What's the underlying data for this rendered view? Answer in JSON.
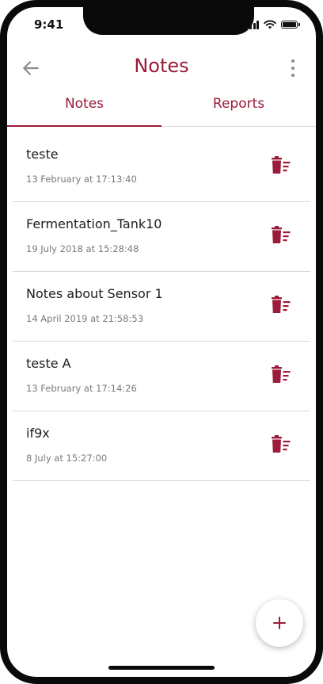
{
  "status_bar": {
    "time": "9:41"
  },
  "appbar": {
    "title": "Notes"
  },
  "tabs": [
    {
      "label": "Notes",
      "active": true
    },
    {
      "label": "Reports",
      "active": false
    }
  ],
  "notes": [
    {
      "title": "teste",
      "date": "13 February at 17:13:40"
    },
    {
      "title": "Fermentation_Tank10",
      "date": "19 July 2018 at 15:28:48"
    },
    {
      "title": "Notes about Sensor 1",
      "date": "14 April 2019 at 21:58:53"
    },
    {
      "title": "teste A",
      "date": "13 February at 17:14:26"
    },
    {
      "title": "if9x",
      "date": "8 July at 15:27:00"
    }
  ],
  "icons": {
    "back": "arrow-left-icon",
    "more": "more-vertical-icon",
    "delete": "delete-sweep-icon",
    "add": "plus-icon"
  },
  "colors": {
    "accent": "#9b1b3a",
    "divider": "#d9d9d9"
  }
}
